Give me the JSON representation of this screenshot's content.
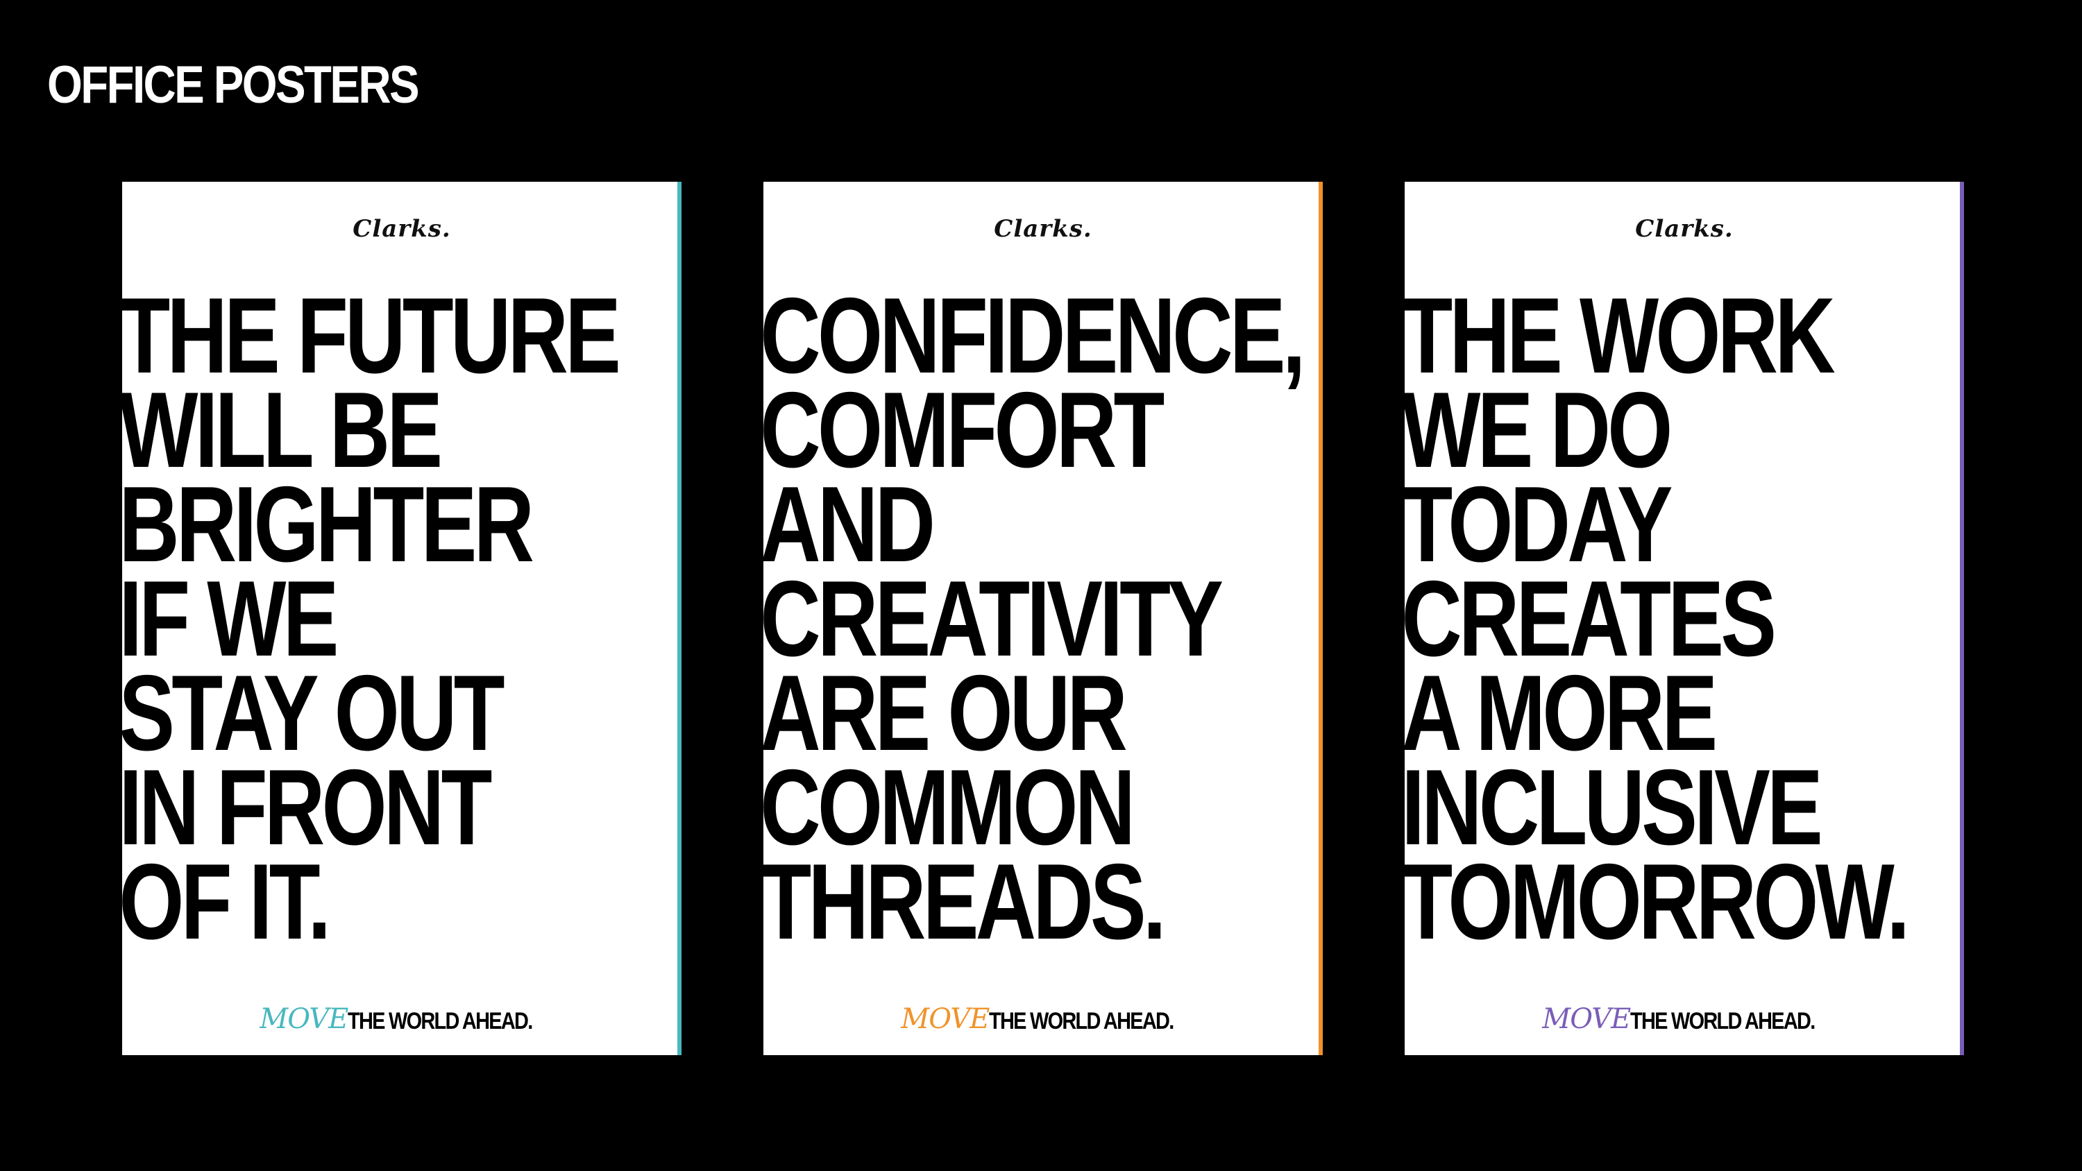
{
  "page": {
    "title": "OFFICE POSTERS"
  },
  "posters": [
    {
      "logo": "Clarks.",
      "accent_color": "#48b8bd",
      "lines": [
        "THE FUTURE",
        "WILL BE",
        "BRIGHTER",
        "IF WE",
        "STAY OUT",
        "IN FRONT",
        "OF IT."
      ],
      "tagline_move": "MOVE",
      "tagline_rest": "THE WORLD AHEAD."
    },
    {
      "logo": "Clarks.",
      "accent_color": "#f0932b",
      "lines": [
        "CONFIDENCE,",
        "COMFORT",
        "AND",
        "CREATIVITY",
        "ARE OUR",
        "COMMON",
        "THREADS."
      ],
      "tagline_move": "MOVE",
      "tagline_rest": "THE WORLD AHEAD."
    },
    {
      "logo": "Clarks.",
      "accent_color": "#7a5db8",
      "lines": [
        "THE WORK",
        "WE DO",
        "TODAY",
        "CREATES",
        "A MORE",
        "INCLUSIVE",
        "TOMORROW."
      ],
      "tagline_move": "MOVE",
      "tagline_rest": "THE WORLD AHEAD."
    }
  ]
}
